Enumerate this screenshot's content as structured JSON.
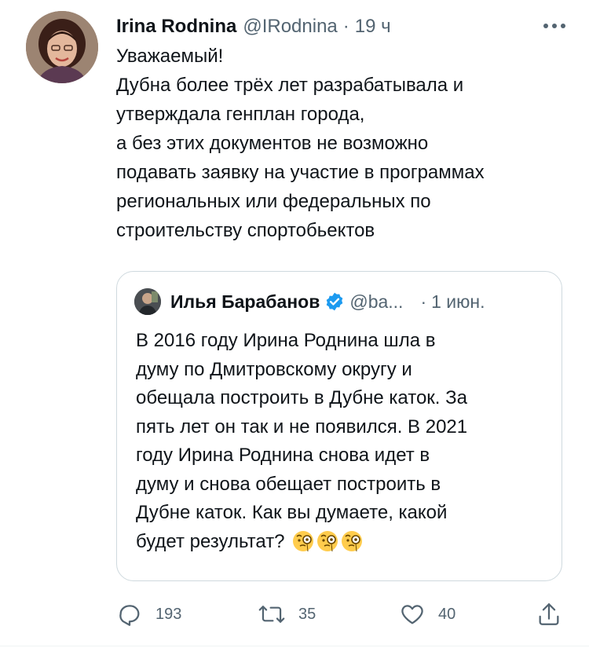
{
  "tweet": {
    "author_name": "Irina Rodnina",
    "author_handle": "@IRodnina",
    "separator": "·",
    "time": "19 ч",
    "body_lines": [
      "Уважаемый!",
      "Дубна более трёх лет разрабатывала и",
      "утверждала генплан города,",
      "а без этих документов не возможно",
      "подавать заявку на участие в программах",
      "региональных или федеральных по",
      "строительству спортобьектов"
    ]
  },
  "quoted_tweet": {
    "author_name": "Илья Барабанов",
    "verified": true,
    "author_handle": "@ba...",
    "separator": "·",
    "time": "1 июн.",
    "body_lines": [
      "В 2016 году Ирина Роднина шла в",
      "думу по Дмитровскому округу и",
      "обещала построить в Дубне каток. За",
      "пять лет он так и не появился. В 2021",
      "году Ирина Роднина снова идет в",
      "думу и снова обещает построить в",
      "Дубне каток. Как вы думаете, какой",
      "будет результат?"
    ],
    "emojis": [
      "monocle-face",
      "monocle-face",
      "monocle-face"
    ]
  },
  "actions": {
    "reply_count": "193",
    "retweet_count": "35",
    "like_count": "40"
  },
  "colors": {
    "text": "#0f1419",
    "secondary": "#536471",
    "verified": "#1d9bf0",
    "border": "#cfd9de"
  }
}
